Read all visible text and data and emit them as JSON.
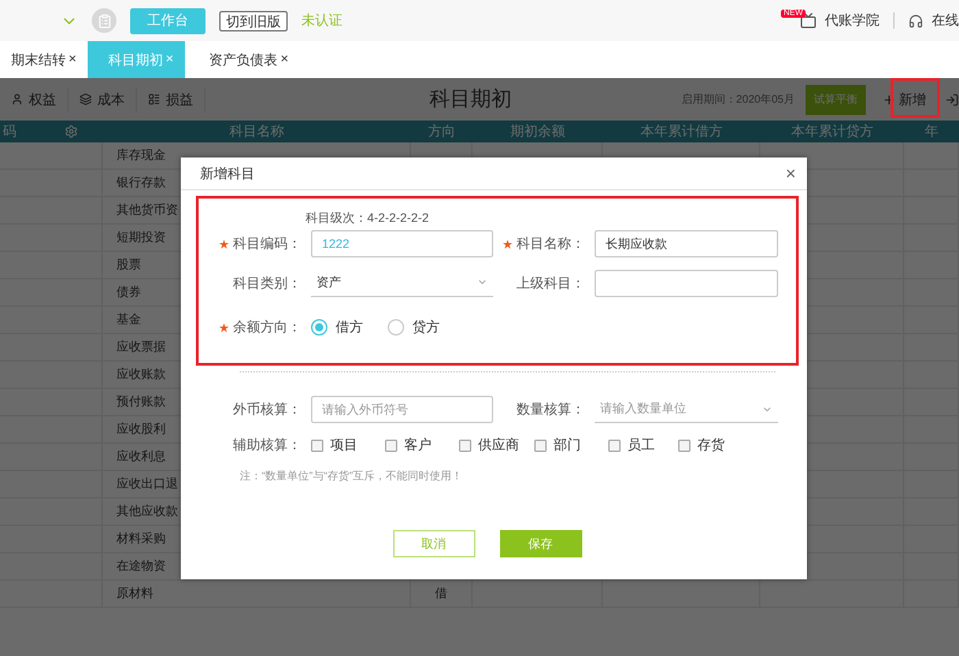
{
  "top_bar": {
    "workbench_button": "工作台",
    "switch_button": "切到旧版",
    "status": "未认证",
    "academy": {
      "badge": "NEW",
      "label": "代账学院"
    },
    "online": "在线"
  },
  "tabs": [
    {
      "label": "期末结转",
      "close": "×",
      "selected": false
    },
    {
      "label": "科目期初",
      "close": "×",
      "selected": true
    },
    {
      "label": "资产负债表",
      "close": "×",
      "selected": false
    }
  ],
  "toolbar": {
    "filters": [
      "权益",
      "成本",
      "损益"
    ],
    "title": "科目期初",
    "period": "启用期间：2020年05月",
    "balance_button": "试算平衡",
    "add_button": {
      "label": "新增",
      "highlighted": true
    }
  },
  "table": {
    "columns": [
      "码",
      "科目名称",
      "方向",
      "期初余额",
      "本年累计借方",
      "本年累计贷方",
      "年"
    ],
    "rows": [
      {
        "name": "库存现金"
      },
      {
        "name": "银行存款"
      },
      {
        "name": "其他货币资"
      },
      {
        "name": "短期投资"
      },
      {
        "name": "股票"
      },
      {
        "name": "债券"
      },
      {
        "name": "基金"
      },
      {
        "name": "应收票据"
      },
      {
        "name": "应收账款"
      },
      {
        "name": "预付账款"
      },
      {
        "name": "应收股利"
      },
      {
        "name": "应收利息"
      },
      {
        "name": "应收出口退"
      },
      {
        "name": "其他应收款"
      },
      {
        "name": "材料采购"
      },
      {
        "name": "在途物资"
      },
      {
        "name": "原材料",
        "direction": "借"
      }
    ]
  },
  "dialog": {
    "title": "新增科目",
    "close": "×",
    "highlighted": true,
    "level_hint": "科目级次：4-2-2-2-2-2",
    "code": {
      "label": "科目编码：",
      "required": true,
      "value": "1222"
    },
    "name": {
      "label": "科目名称：",
      "required": true,
      "value": "长期应收款"
    },
    "category": {
      "label": "科目类别：",
      "value": "资产"
    },
    "parent": {
      "label": "上级科目："
    },
    "direction": {
      "label": "余额方向：",
      "required": true,
      "options": [
        {
          "label": "借方",
          "selected": true
        },
        {
          "label": "贷方",
          "selected": false
        }
      ]
    },
    "currency": {
      "label": "外币核算：",
      "placeholder": "请输入外币符号"
    },
    "quantity": {
      "label": "数量核算：",
      "placeholder": "请输入数量单位"
    },
    "auxiliary": {
      "label": "辅助核算：",
      "options": [
        {
          "label": "项目",
          "checked": false
        },
        {
          "label": "客户",
          "checked": false
        },
        {
          "label": "供应商",
          "checked": false
        },
        {
          "label": "部门",
          "checked": false
        },
        {
          "label": "员工",
          "checked": false
        },
        {
          "label": "存货",
          "checked": false
        }
      ]
    },
    "note": "注：“数量单位”与“存货”互斥，不能同时使用！",
    "buttons": {
      "cancel": "取消",
      "save": "保存"
    }
  }
}
